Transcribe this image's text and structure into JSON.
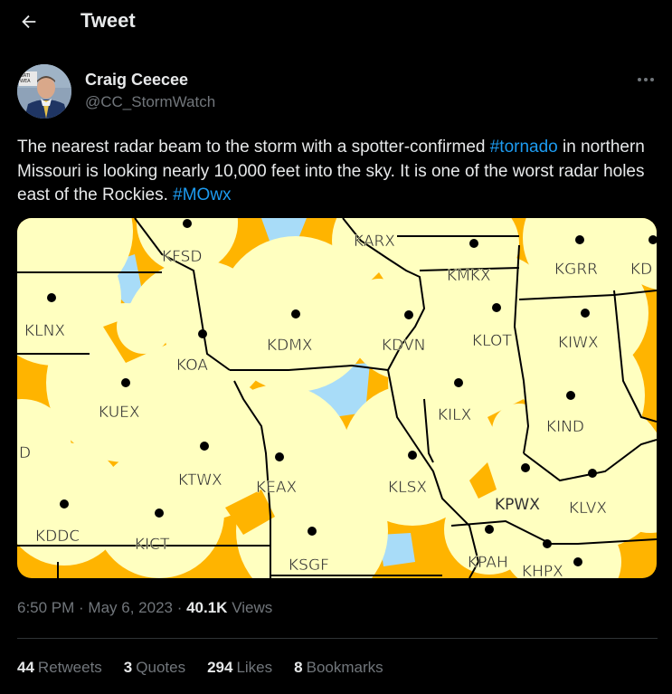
{
  "header": {
    "title": "Tweet",
    "back_icon": "arrow-left-icon"
  },
  "author": {
    "name": "Craig Ceecee",
    "handle": "@CC_StormWatch",
    "avatar_badge": "NATIONAL WEATHER ASSOCIATION",
    "more_icon": "more-horizontal-icon"
  },
  "tweet": {
    "text_1": "The nearest radar beam to the storm with a spotter-confirmed ",
    "hashtag_1": "#tornado",
    "text_2": " in northern Missouri is looking nearly 10,000 feet into the sky. It is one of the worst radar holes east of the Rockies. ",
    "hashtag_2": "#MOwx"
  },
  "map": {
    "colors": {
      "covered": "#ffffc0",
      "gap": "#ffb400",
      "hole": "#a8dcf8",
      "border": "#000000"
    },
    "radar_labels": [
      "KFSD",
      "KARX",
      "KMKX",
      "KGRR",
      "KD",
      "KLNX",
      "KDMX",
      "KOA",
      "KDVN",
      "KLOT",
      "KIWX",
      "KUEX",
      "KILX",
      "KIND",
      "D",
      "KTWX",
      "KEAX",
      "KLSX",
      "KLVX",
      "KDDC",
      "KICT",
      "KSGF",
      "KPAH",
      "KHPX"
    ]
  },
  "meta": {
    "time": "6:50 PM",
    "sep1": " · ",
    "date": "May 6, 2023",
    "sep2": " · ",
    "views_count": "40.1K",
    "views_label": " Views"
  },
  "stats": [
    {
      "count": "44",
      "label": "Retweets"
    },
    {
      "count": "3",
      "label": "Quotes"
    },
    {
      "count": "294",
      "label": "Likes"
    },
    {
      "count": "8",
      "label": "Bookmarks"
    }
  ]
}
